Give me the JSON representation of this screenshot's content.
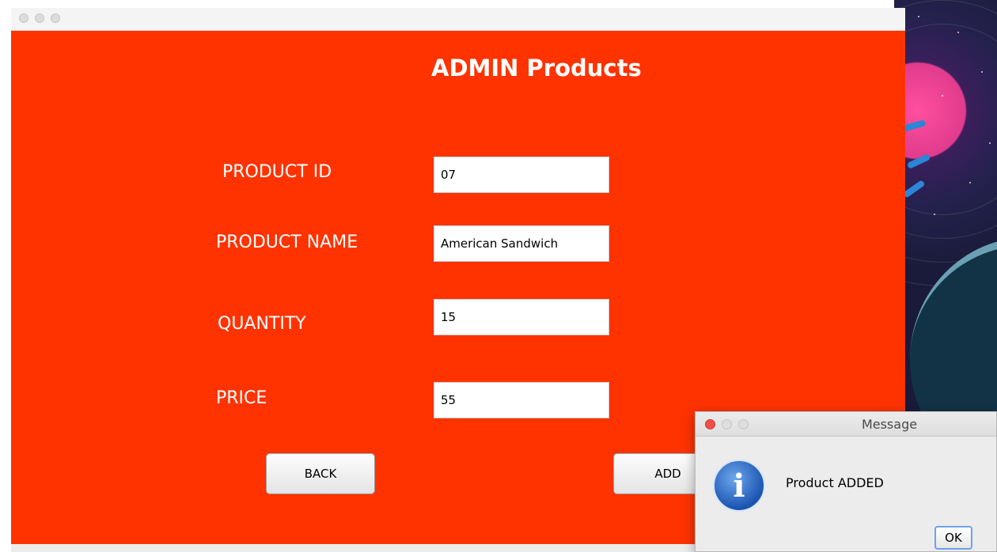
{
  "window": {
    "heading": "ADMIN Products",
    "accent_color": "#ff3300"
  },
  "form": {
    "product_id": {
      "label": "PRODUCT ID",
      "value": "07"
    },
    "product_name": {
      "label": "PRODUCT NAME",
      "value": "American Sandwich"
    },
    "quantity": {
      "label": "QUANTITY",
      "value": "15"
    },
    "price": {
      "label": "PRICE",
      "value": "55"
    }
  },
  "buttons": {
    "back": "BACK",
    "add": "ADD"
  },
  "dialog": {
    "title": "Message",
    "message": "Product ADDED",
    "ok": "OK",
    "icon": "info-icon"
  }
}
